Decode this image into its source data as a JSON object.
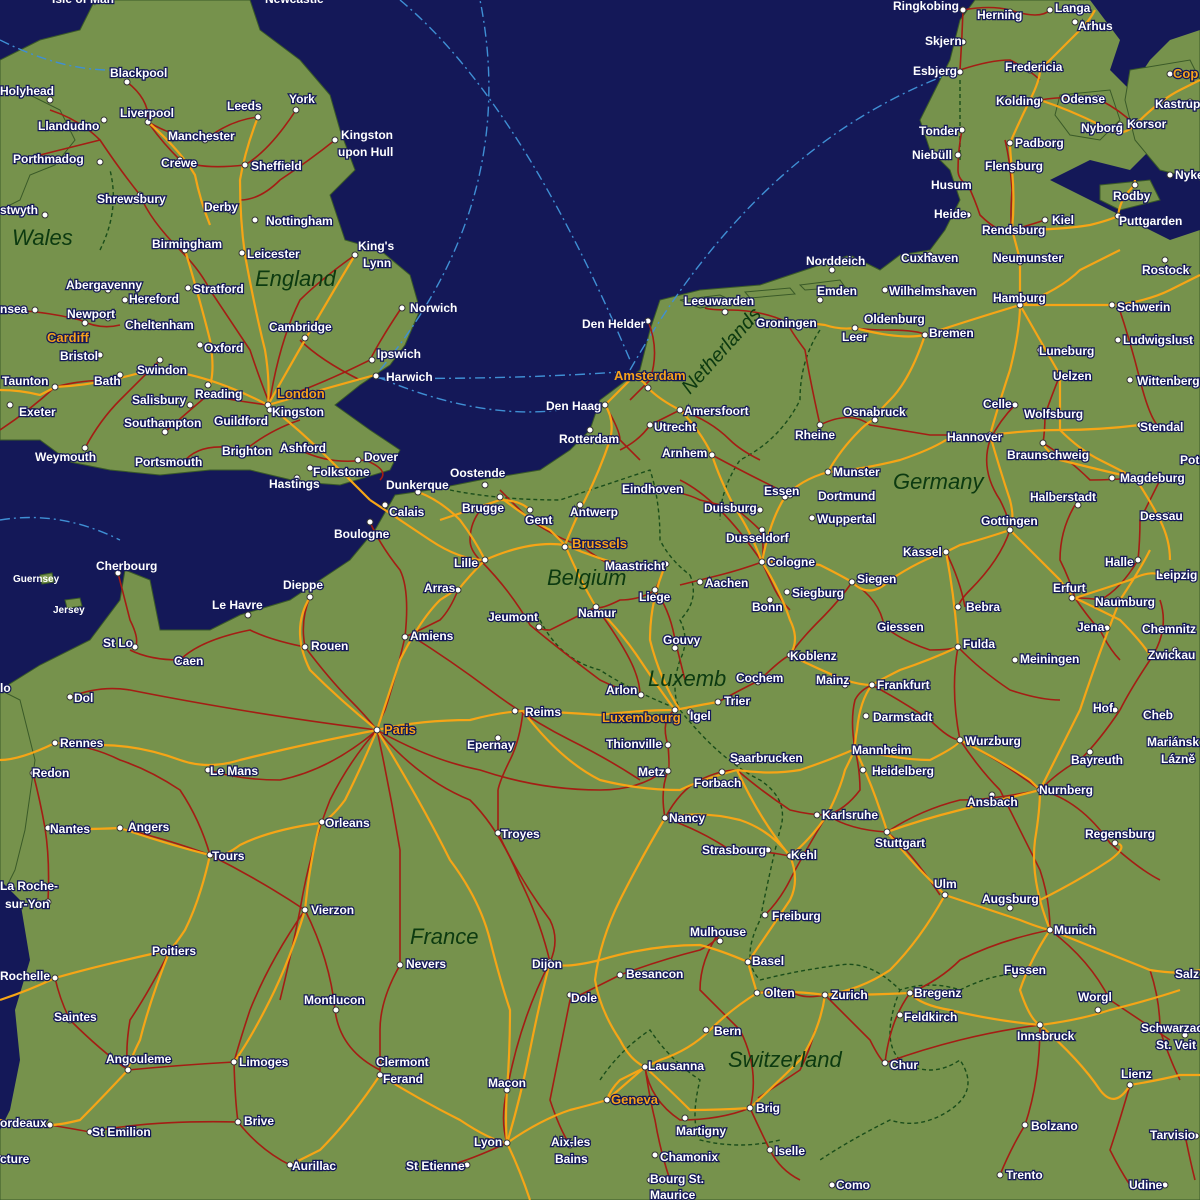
{
  "colors": {
    "sea": "#141858",
    "land": "#76924c",
    "rail_main": "#f6a516",
    "rail_secondary": "#a41d14",
    "city_label": "#ffffff",
    "capital_label": "#f7a21b",
    "country_label": "#0c3a10",
    "border": "#1a4d1a",
    "ferry": "#3f8fd4"
  },
  "countries": [
    {
      "id": "wales",
      "name": "Wales"
    },
    {
      "id": "england",
      "name": "England"
    },
    {
      "id": "netherlands",
      "name": "Netherlands"
    },
    {
      "id": "belgium",
      "name": "Belgium"
    },
    {
      "id": "luxembourg",
      "name": "Luxemb"
    },
    {
      "id": "germany",
      "name": "Germany"
    },
    {
      "id": "france",
      "name": "France"
    },
    {
      "id": "switzerland",
      "name": "Switzerland"
    }
  ],
  "islands": [
    {
      "id": "guernsey",
      "name": "Guernsey"
    },
    {
      "id": "jersey",
      "name": "Jersey"
    }
  ],
  "cities": [
    {
      "id": "isle-of-man",
      "name": "Isle of Man"
    },
    {
      "id": "newcastle",
      "name": "Newcastle"
    },
    {
      "id": "blackpool",
      "name": "Blackpool"
    },
    {
      "id": "holyhead",
      "name": "Holyhead"
    },
    {
      "id": "llandudno",
      "name": "Llandudno"
    },
    {
      "id": "liverpool",
      "name": "Liverpool"
    },
    {
      "id": "leeds",
      "name": "Leeds"
    },
    {
      "id": "york",
      "name": "York"
    },
    {
      "id": "manchester",
      "name": "Manchester"
    },
    {
      "id": "kingston-upon-hull-1",
      "name": "Kingston"
    },
    {
      "id": "kingston-upon-hull-2",
      "name": "upon Hull"
    },
    {
      "id": "porthmadog",
      "name": "Porthmadog"
    },
    {
      "id": "crewe",
      "name": "Crewe"
    },
    {
      "id": "sheffield",
      "name": "Sheffield"
    },
    {
      "id": "shrewsbury",
      "name": "Shrewsbury"
    },
    {
      "id": "derby",
      "name": "Derby"
    },
    {
      "id": "nottingham",
      "name": "Nottingham"
    },
    {
      "id": "aberystwyth",
      "name": "stwyth"
    },
    {
      "id": "birmingham",
      "name": "Birmingham"
    },
    {
      "id": "kings-lynn-1",
      "name": "King's"
    },
    {
      "id": "kings-lynn-2",
      "name": "Lynn"
    },
    {
      "id": "leicester",
      "name": "Leicester"
    },
    {
      "id": "abergavenny",
      "name": "Abergavenny"
    },
    {
      "id": "stratford",
      "name": "Stratford"
    },
    {
      "id": "hereford",
      "name": "Hereford"
    },
    {
      "id": "swansea",
      "name": "nsea"
    },
    {
      "id": "norwich",
      "name": "Norwich"
    },
    {
      "id": "newport",
      "name": "Newport"
    },
    {
      "id": "cheltenham",
      "name": "Cheltenham"
    },
    {
      "id": "cambridge",
      "name": "Cambridge"
    },
    {
      "id": "cardiff",
      "name": "Cardiff",
      "capital": true
    },
    {
      "id": "oxford",
      "name": "Oxford"
    },
    {
      "id": "bristol",
      "name": "Bristol"
    },
    {
      "id": "ipswich",
      "name": "Ipswich"
    },
    {
      "id": "swindon",
      "name": "Swindon"
    },
    {
      "id": "taunton",
      "name": "Taunton"
    },
    {
      "id": "bath",
      "name": "Bath"
    },
    {
      "id": "harwich",
      "name": "Harwich"
    },
    {
      "id": "reading",
      "name": "Reading"
    },
    {
      "id": "london",
      "name": "London",
      "capital": true
    },
    {
      "id": "salisbury",
      "name": "Salisbury"
    },
    {
      "id": "exeter",
      "name": "Exeter"
    },
    {
      "id": "kingston",
      "name": "Kingston"
    },
    {
      "id": "guildford",
      "name": "Guildford"
    },
    {
      "id": "southampton",
      "name": "Southampton"
    },
    {
      "id": "ashford",
      "name": "Ashford"
    },
    {
      "id": "brighton",
      "name": "Brighton"
    },
    {
      "id": "dover",
      "name": "Dover"
    },
    {
      "id": "weymouth",
      "name": "Weymouth"
    },
    {
      "id": "portsmouth",
      "name": "Portsmouth"
    },
    {
      "id": "folkestone",
      "name": "Folkstone"
    },
    {
      "id": "hastings",
      "name": "Hastings"
    },
    {
      "id": "ringkobing",
      "name": "Ringkobing"
    },
    {
      "id": "herning",
      "name": "Herning"
    },
    {
      "id": "langa",
      "name": "Langa"
    },
    {
      "id": "arhus",
      "name": "Arhus"
    },
    {
      "id": "skjern",
      "name": "Skjern"
    },
    {
      "id": "esbjerg",
      "name": "Esbjerg"
    },
    {
      "id": "fredericia",
      "name": "Fredericia"
    },
    {
      "id": "copenhagen",
      "name": "Cop",
      "capital": true
    },
    {
      "id": "kolding",
      "name": "Kolding"
    },
    {
      "id": "odense",
      "name": "Odense"
    },
    {
      "id": "kastrup",
      "name": "Kastrup"
    },
    {
      "id": "nyborg",
      "name": "Nyborg"
    },
    {
      "id": "korsor",
      "name": "Korsor"
    },
    {
      "id": "tonder",
      "name": "Tonder"
    },
    {
      "id": "padborg",
      "name": "Padborg"
    },
    {
      "id": "niebull",
      "name": "Niebüll"
    },
    {
      "id": "flensburg",
      "name": "Flensburg"
    },
    {
      "id": "nykobing",
      "name": "Nyke"
    },
    {
      "id": "husum",
      "name": "Husum"
    },
    {
      "id": "rodby",
      "name": "Rodby"
    },
    {
      "id": "heide",
      "name": "Heide"
    },
    {
      "id": "kiel",
      "name": "Kiel"
    },
    {
      "id": "puttgarden",
      "name": "Puttgarden"
    },
    {
      "id": "rendsburg",
      "name": "Rendsburg"
    },
    {
      "id": "norddeich",
      "name": "Norddeich"
    },
    {
      "id": "cuxhaven",
      "name": "Cuxhaven"
    },
    {
      "id": "neumunster",
      "name": "Neumunster"
    },
    {
      "id": "rostock",
      "name": "Rostock"
    },
    {
      "id": "emden",
      "name": "Emden"
    },
    {
      "id": "wilhelmshaven",
      "name": "Wilhelmshaven"
    },
    {
      "id": "leeuwarden",
      "name": "Leeuwarden"
    },
    {
      "id": "hamburg",
      "name": "Hamburg"
    },
    {
      "id": "schwerin",
      "name": "Schwerin"
    },
    {
      "id": "den-helder",
      "name": "Den Helder"
    },
    {
      "id": "groningen",
      "name": "Groningen"
    },
    {
      "id": "oldenburg",
      "name": "Oldenburg"
    },
    {
      "id": "leer",
      "name": "Leer"
    },
    {
      "id": "bremen",
      "name": "Bremen"
    },
    {
      "id": "ludwigslust",
      "name": "Ludwigslust"
    },
    {
      "id": "luneburg",
      "name": "Luneburg"
    },
    {
      "id": "amsterdam",
      "name": "Amsterdam",
      "capital": true
    },
    {
      "id": "uelzen",
      "name": "Uelzen"
    },
    {
      "id": "wittenberg",
      "name": "Wittenberg"
    },
    {
      "id": "den-haag",
      "name": "Den Haag"
    },
    {
      "id": "amersfoort",
      "name": "Amersfoort"
    },
    {
      "id": "osnabruck",
      "name": "Osnabruck"
    },
    {
      "id": "celle",
      "name": "Celle"
    },
    {
      "id": "wolfsburg",
      "name": "Wolfsburg"
    },
    {
      "id": "utrecht",
      "name": "Utrecht"
    },
    {
      "id": "rotterdam",
      "name": "Rotterdam"
    },
    {
      "id": "rheine",
      "name": "Rheine"
    },
    {
      "id": "hannover",
      "name": "Hannover"
    },
    {
      "id": "stendal",
      "name": "Stendal"
    },
    {
      "id": "arnhem",
      "name": "Arnhem"
    },
    {
      "id": "braunschweig",
      "name": "Braunschweig"
    },
    {
      "id": "munster",
      "name": "Munster"
    },
    {
      "id": "potsdam",
      "name": "Pots"
    },
    {
      "id": "oostende",
      "name": "Oostende"
    },
    {
      "id": "dunkerque",
      "name": "Dunkerque"
    },
    {
      "id": "eindhoven",
      "name": "Eindhoven"
    },
    {
      "id": "essen",
      "name": "Essen"
    },
    {
      "id": "magdeburg",
      "name": "Magdeburg"
    },
    {
      "id": "dortmund",
      "name": "Dortmund"
    },
    {
      "id": "halberstadt",
      "name": "Halberstadt"
    },
    {
      "id": "brugge",
      "name": "Brugge"
    },
    {
      "id": "calais",
      "name": "Calais"
    },
    {
      "id": "antwerp",
      "name": "Antwerp"
    },
    {
      "id": "duisburg",
      "name": "Duisburg"
    },
    {
      "id": "gent",
      "name": "Gent"
    },
    {
      "id": "wuppertal",
      "name": "Wuppertal"
    },
    {
      "id": "dessau",
      "name": "Dessau"
    },
    {
      "id": "boulogne",
      "name": "Boulogne"
    },
    {
      "id": "dusseldorf",
      "name": "Dusseldorf"
    },
    {
      "id": "gottingen",
      "name": "Gottingen"
    },
    {
      "id": "brussels",
      "name": "Brussels",
      "capital": true
    },
    {
      "id": "kassel",
      "name": "Kassel"
    },
    {
      "id": "lille",
      "name": "Lille"
    },
    {
      "id": "maastricht",
      "name": "Maastricht"
    },
    {
      "id": "cologne",
      "name": "Cologne"
    },
    {
      "id": "halle",
      "name": "Halle"
    },
    {
      "id": "cherbourg",
      "name": "Cherbourg"
    },
    {
      "id": "leipzig",
      "name": "Leipzig"
    },
    {
      "id": "siegen",
      "name": "Siegen"
    },
    {
      "id": "aachen",
      "name": "Aachen"
    },
    {
      "id": "dieppe",
      "name": "Dieppe"
    },
    {
      "id": "arras",
      "name": "Arras"
    },
    {
      "id": "erfurt",
      "name": "Erfurt"
    },
    {
      "id": "siegburg",
      "name": "Siegburg"
    },
    {
      "id": "liege",
      "name": "Liege"
    },
    {
      "id": "le-havre",
      "name": "Le Havre"
    },
    {
      "id": "naumburg",
      "name": "Naumburg"
    },
    {
      "id": "bebra",
      "name": "Bebra"
    },
    {
      "id": "namur",
      "name": "Namur"
    },
    {
      "id": "bonn",
      "name": "Bonn"
    },
    {
      "id": "jeumont",
      "name": "Jeumont"
    },
    {
      "id": "giessen",
      "name": "Giessen"
    },
    {
      "id": "jena",
      "name": "Jena"
    },
    {
      "id": "chemnitz",
      "name": "Chemnitz"
    },
    {
      "id": "st-lo",
      "name": "St Lo"
    },
    {
      "id": "amiens",
      "name": "Amiens"
    },
    {
      "id": "rouen",
      "name": "Rouen"
    },
    {
      "id": "gouvy",
      "name": "Gouvy"
    },
    {
      "id": "fulda",
      "name": "Fulda"
    },
    {
      "id": "koblenz",
      "name": "Koblenz"
    },
    {
      "id": "zwickau",
      "name": "Zwickau"
    },
    {
      "id": "caen",
      "name": "Caen"
    },
    {
      "id": "meiningen",
      "name": "Meiningen"
    },
    {
      "id": "cochem",
      "name": "Cochem"
    },
    {
      "id": "mainz",
      "name": "Mainz"
    },
    {
      "id": "frankfurt",
      "name": "Frankfurt"
    },
    {
      "id": "st-malo",
      "name": "lo"
    },
    {
      "id": "arlon",
      "name": "Arlon"
    },
    {
      "id": "dol",
      "name": "Dol"
    },
    {
      "id": "trier",
      "name": "Trier"
    },
    {
      "id": "reims",
      "name": "Reims"
    },
    {
      "id": "luxembourg",
      "name": "Luxembourg",
      "capital": true
    },
    {
      "id": "igel",
      "name": "Igel"
    },
    {
      "id": "hof",
      "name": "Hof"
    },
    {
      "id": "darmstadt",
      "name": "Darmstadt"
    },
    {
      "id": "cheb",
      "name": "Cheb"
    },
    {
      "id": "paris",
      "name": "Paris",
      "capital": true
    },
    {
      "id": "wurzburg",
      "name": "Wurzburg"
    },
    {
      "id": "rennes",
      "name": "Rennes"
    },
    {
      "id": "epernay",
      "name": "Epernay"
    },
    {
      "id": "thionville",
      "name": "Thionville"
    },
    {
      "id": "mannheim",
      "name": "Mannheim"
    },
    {
      "id": "marianske-1",
      "name": "Mariánsk"
    },
    {
      "id": "marianske-2",
      "name": "Lázně"
    },
    {
      "id": "bayreuth",
      "name": "Bayreuth"
    },
    {
      "id": "saarbrucken",
      "name": "Saarbrucken"
    },
    {
      "id": "le-mans",
      "name": "Le Mans"
    },
    {
      "id": "heidelberg",
      "name": "Heidelberg"
    },
    {
      "id": "redon",
      "name": "Redon"
    },
    {
      "id": "metz",
      "name": "Metz"
    },
    {
      "id": "forbach",
      "name": "Forbach"
    },
    {
      "id": "nurnberg",
      "name": "Nurnberg"
    },
    {
      "id": "ansbach",
      "name": "Ansbach"
    },
    {
      "id": "karlsruhe",
      "name": "Karlsruhe"
    },
    {
      "id": "nancy",
      "name": "Nancy"
    },
    {
      "id": "orleans",
      "name": "Orleans"
    },
    {
      "id": "nantes",
      "name": "Nantes"
    },
    {
      "id": "angers",
      "name": "Angers"
    },
    {
      "id": "troyes",
      "name": "Troyes"
    },
    {
      "id": "regensburg",
      "name": "Regensburg"
    },
    {
      "id": "stuttgart",
      "name": "Stuttgart"
    },
    {
      "id": "strasbourg",
      "name": "Strasbourg"
    },
    {
      "id": "kehl",
      "name": "Kehl"
    },
    {
      "id": "tours",
      "name": "Tours"
    },
    {
      "id": "la-roche-1",
      "name": "La Roche-"
    },
    {
      "id": "la-roche-2",
      "name": "sur-Yon"
    },
    {
      "id": "ulm",
      "name": "Ulm"
    },
    {
      "id": "augsburg",
      "name": "Augsburg"
    },
    {
      "id": "vierzon",
      "name": "Vierzon"
    },
    {
      "id": "freiburg",
      "name": "Freiburg"
    },
    {
      "id": "mulhouse",
      "name": "Mulhouse"
    },
    {
      "id": "munich",
      "name": "Munich"
    },
    {
      "id": "poitiers",
      "name": "Poitiers"
    },
    {
      "id": "basel",
      "name": "Basel"
    },
    {
      "id": "dijon",
      "name": "Dijon"
    },
    {
      "id": "nevers",
      "name": "Nevers"
    },
    {
      "id": "fussen",
      "name": "Fussen"
    },
    {
      "id": "la-rochelle",
      "name": "Rochelle"
    },
    {
      "id": "besancon",
      "name": "Besancon"
    },
    {
      "id": "salzburg",
      "name": "Salz"
    },
    {
      "id": "olten",
      "name": "Olten"
    },
    {
      "id": "zurich",
      "name": "Zurich"
    },
    {
      "id": "bregenz",
      "name": "Bregenz"
    },
    {
      "id": "dole",
      "name": "Dole"
    },
    {
      "id": "worgl",
      "name": "Worgl"
    },
    {
      "id": "montlucon",
      "name": "Montlucon"
    },
    {
      "id": "saintes",
      "name": "Saintes"
    },
    {
      "id": "feldkirch",
      "name": "Feldkirch"
    },
    {
      "id": "schwarzach-1",
      "name": "Schwarzac"
    },
    {
      "id": "schwarzach-2",
      "name": "St. Veit"
    },
    {
      "id": "bern",
      "name": "Bern"
    },
    {
      "id": "innsbruck",
      "name": "Innsbruck"
    },
    {
      "id": "angouleme",
      "name": "Angouleme"
    },
    {
      "id": "limoges",
      "name": "Limoges"
    },
    {
      "id": "clermont-1",
      "name": "Clermont"
    },
    {
      "id": "clermont-2",
      "name": "Ferand"
    },
    {
      "id": "lausanne",
      "name": "Lausanna"
    },
    {
      "id": "chur",
      "name": "Chur"
    },
    {
      "id": "lienz",
      "name": "Lienz"
    },
    {
      "id": "macon",
      "name": "Macon"
    },
    {
      "id": "geneva",
      "name": "Geneva",
      "capital": true
    },
    {
      "id": "brig",
      "name": "Brig"
    },
    {
      "id": "bordeaux",
      "name": "ordeaux"
    },
    {
      "id": "brive",
      "name": "Brive"
    },
    {
      "id": "bolzano",
      "name": "Bolzano"
    },
    {
      "id": "martigny",
      "name": "Martigny"
    },
    {
      "id": "st-emilion",
      "name": "St Emilion"
    },
    {
      "id": "tarvisio",
      "name": "Tarvisio"
    },
    {
      "id": "aix-les-bains-1",
      "name": "Aix-les"
    },
    {
      "id": "aix-les-bains-2",
      "name": "Bains"
    },
    {
      "id": "lyon",
      "name": "Lyon"
    },
    {
      "id": "iselle",
      "name": "Iselle"
    },
    {
      "id": "chamonix",
      "name": "Chamonix"
    },
    {
      "id": "arcachon",
      "name": "cture"
    },
    {
      "id": "aurillac",
      "name": "Aurillac"
    },
    {
      "id": "st-etienne",
      "name": "St Etienne"
    },
    {
      "id": "trento",
      "name": "Trento"
    },
    {
      "id": "bourg-1",
      "name": "Bourg St."
    },
    {
      "id": "bourg-2",
      "name": "Maurice"
    },
    {
      "id": "como",
      "name": "Como"
    },
    {
      "id": "udine",
      "name": "Udine"
    }
  ]
}
